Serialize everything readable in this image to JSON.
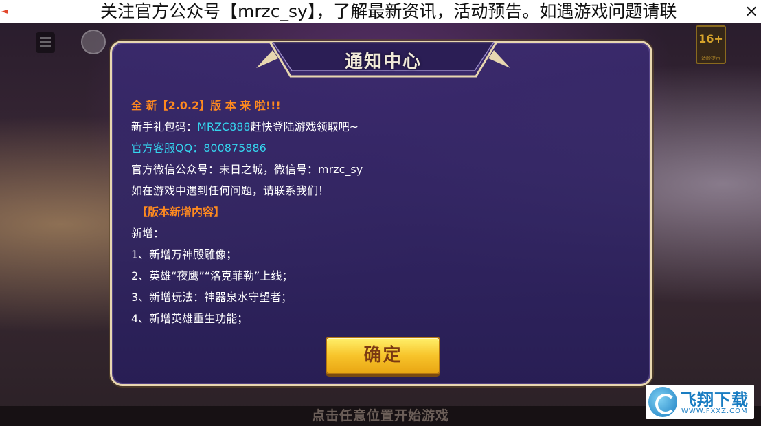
{
  "marquee": {
    "text": "关注官方公众号【mrzc_sy】，了解最新资讯，活动预告。如遇游戏问题请联",
    "close_glyph": "×"
  },
  "background": {
    "age_badge": "16+",
    "age_badge_sub": "适龄提示",
    "start_hint": "点击任意位置开始游戏"
  },
  "dialog": {
    "title": "通知中心",
    "lines": [
      {
        "segments": [
          {
            "text": "全 新【2.0.2】版 本 来 啦!!!",
            "color": "orange"
          }
        ]
      },
      {
        "segments": [
          {
            "text": "新手礼包码：",
            "color": "white"
          },
          {
            "text": "MRZC888",
            "color": "cyan"
          },
          {
            "text": "赶快登陆游戏领取吧~",
            "color": "white"
          }
        ]
      },
      {
        "segments": [
          {
            "text": "官方客服QQ：800875886",
            "color": "cyan"
          }
        ]
      },
      {
        "segments": [
          {
            "text": "官方微信公众号：末日之城，微信号：mrzc_sy",
            "color": "white"
          }
        ]
      },
      {
        "segments": [
          {
            "text": "如在游戏中遇到任何问题，请联系我们！",
            "color": "white"
          }
        ]
      },
      {
        "segments": [
          {
            "text": "【版本新增内容】",
            "color": "orange"
          }
        ],
        "section": true
      },
      {
        "segments": [
          {
            "text": "新增：",
            "color": "white"
          }
        ]
      },
      {
        "segments": [
          {
            "text": "1、新增万神殿雕像；",
            "color": "white"
          }
        ]
      },
      {
        "segments": [
          {
            "text": "2、英雄“夜鹰”“洛克菲勒”上线；",
            "color": "white"
          }
        ]
      },
      {
        "segments": [
          {
            "text": "3、新增玩法：神器泉水守望者；",
            "color": "white"
          }
        ]
      },
      {
        "segments": [
          {
            "text": "4、新增英雄重生功能；",
            "color": "white"
          }
        ]
      }
    ],
    "ok_label": "确定"
  },
  "watermark": {
    "name": "飞翔下载",
    "url": "WWW.FXXZ.COM"
  },
  "colors": {
    "orange": "#ff8a1f",
    "cyan": "#35d4ee",
    "button_gold": "#f7c42b",
    "panel_purple": "#3a2a6e"
  }
}
